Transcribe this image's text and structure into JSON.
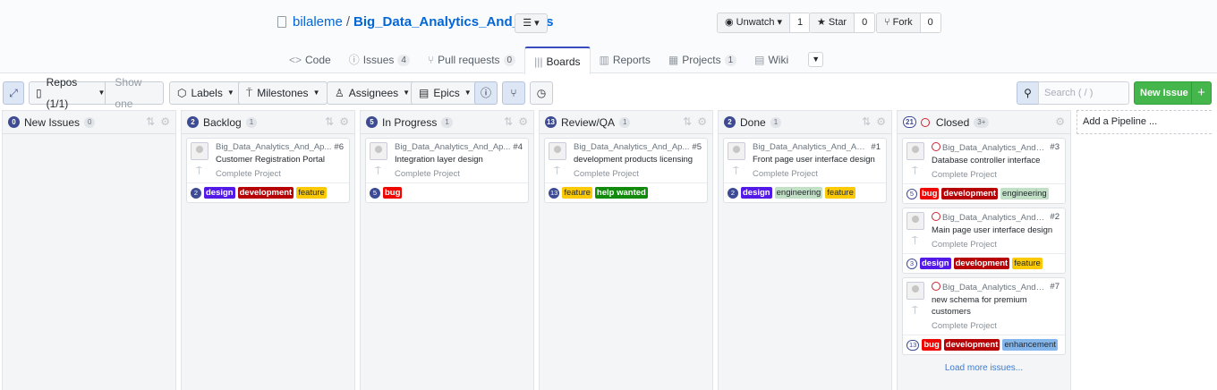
{
  "repo": {
    "owner": "bilaleme",
    "separator": "/",
    "name": "Big_Data_Analytics_And_Apps",
    "menu_icon": "list-icon"
  },
  "actions": [
    {
      "id": "watch",
      "icon": "eye-icon",
      "label": "Unwatch ▾",
      "count": "1"
    },
    {
      "id": "star",
      "icon": "star-icon",
      "label": "Star",
      "count": "0"
    },
    {
      "id": "fork",
      "icon": "fork-icon",
      "label": "Fork",
      "count": "0"
    }
  ],
  "tabs": [
    {
      "label": "Code",
      "icon": "<>",
      "count": ""
    },
    {
      "label": "Issues",
      "icon": "ⓘ",
      "count": "4"
    },
    {
      "label": "Pull requests",
      "icon": "⑂",
      "count": "0"
    },
    {
      "label": "Boards",
      "icon": "|||",
      "count": "",
      "selected": true
    },
    {
      "label": "Reports",
      "icon": "▥",
      "count": ""
    },
    {
      "label": "Projects",
      "icon": "▦",
      "count": "1"
    },
    {
      "label": "Wiki",
      "icon": "▤",
      "count": ""
    }
  ],
  "toolbar": {
    "repos": "Repos (1/1)",
    "show_one": "Show one",
    "labels": "Labels",
    "milestones": "Milestones",
    "assignees": "Assignees",
    "epics": "Epics",
    "search_placeholder": "Search ( / )",
    "new_issue": "New Issue",
    "add_pipeline": "Add a Pipeline ..."
  },
  "colors": {
    "design": "#5319e7",
    "development": "#b60205",
    "feature": "#fbca04",
    "help wanted": "#128a0c",
    "bug": "#ee0701",
    "engineering": "#c2e0c6",
    "enhancement": "#84b6eb",
    "accent": "#3d4a94",
    "new_issue": "#45b64b"
  },
  "columns": [
    {
      "name": "New Issues",
      "count": "0",
      "num": "0",
      "num_outline": false,
      "cards": []
    },
    {
      "name": "Backlog",
      "count": "1",
      "num": "2",
      "num_outline": false,
      "cards": [
        {
          "repo": "Big_Data_Analytics_And_Ap...",
          "number": "#6",
          "title": "Customer Registration Portal",
          "milestone": "Complete Project",
          "estimate": "2",
          "labels": [
            "design",
            "development",
            "feature"
          ]
        }
      ]
    },
    {
      "name": "In Progress",
      "count": "1",
      "num": "5",
      "num_outline": false,
      "cards": [
        {
          "repo": "Big_Data_Analytics_And_Ap...",
          "number": "#4",
          "title": "Integration layer design",
          "milestone": "Complete Project",
          "estimate": "5",
          "labels": [
            "bug"
          ]
        }
      ]
    },
    {
      "name": "Review/QA",
      "count": "1",
      "num": "13",
      "num_outline": false,
      "cards": [
        {
          "repo": "Big_Data_Analytics_And_Ap...",
          "number": "#5",
          "title": "development products licensing",
          "milestone": "Complete Project",
          "estimate": "13",
          "labels": [
            "feature",
            "help wanted"
          ]
        }
      ]
    },
    {
      "name": "Done",
      "count": "1",
      "num": "2",
      "num_outline": false,
      "cards": [
        {
          "repo": "Big_Data_Analytics_And_Apps",
          "number": "#1",
          "title": "Front page user interface design",
          "milestone": "Complete Project",
          "estimate": "2",
          "labels": [
            "design",
            "engineering",
            "feature"
          ]
        }
      ]
    },
    {
      "name": "Closed",
      "count": "3+",
      "num": "21",
      "num_outline": true,
      "closed": true,
      "load_more": "Load more issues...",
      "cards": [
        {
          "repo": "Big_Data_Analytics_And_Ap...",
          "number": "#3",
          "title": "Database controller interface",
          "milestone": "Complete Project",
          "estimate": "5",
          "estimate_outline": true,
          "closed": true,
          "labels": [
            "bug",
            "development",
            "engineering"
          ]
        },
        {
          "repo": "Big_Data_Analytics_And_Ap...",
          "number": "#2",
          "title": "Main page user interface design",
          "milestone": "Complete Project",
          "estimate": "3",
          "estimate_outline": true,
          "closed": true,
          "labels": [
            "design",
            "development",
            "feature"
          ]
        },
        {
          "repo": "Big_Data_Analytics_And_Ap...",
          "number": "#7",
          "title": "new schema for premium customers",
          "milestone": "Complete Project",
          "estimate": "13",
          "estimate_outline": true,
          "closed": true,
          "labels": [
            "bug",
            "development",
            "enhancement"
          ]
        }
      ]
    }
  ]
}
